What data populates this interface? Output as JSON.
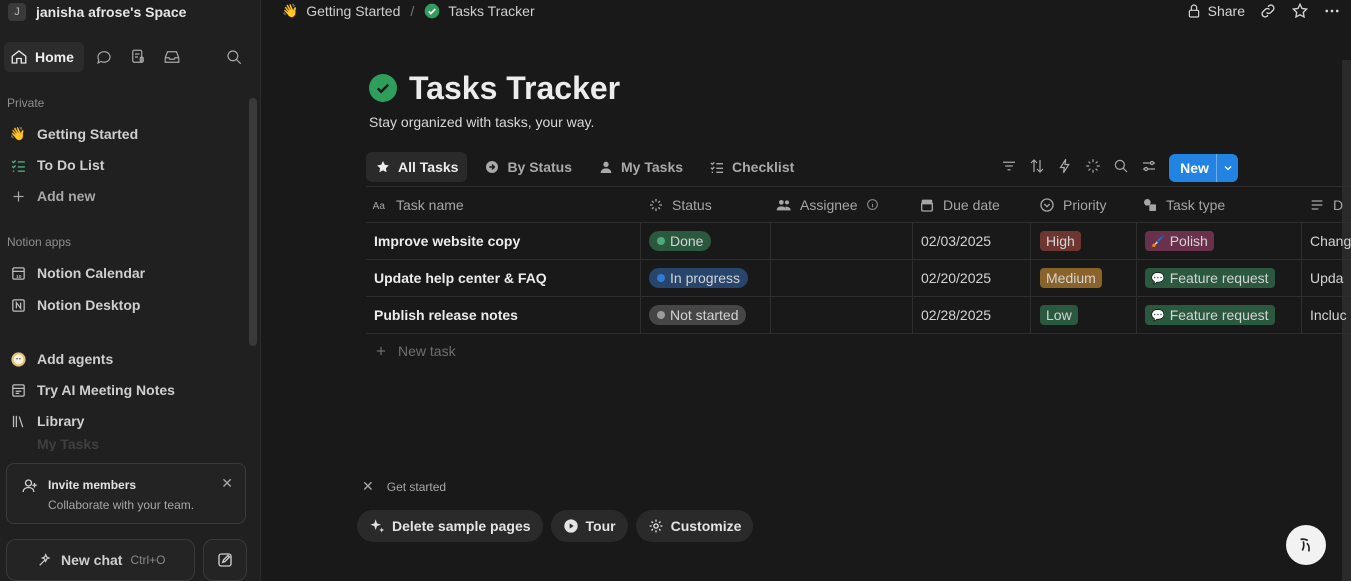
{
  "workspace": {
    "badge": "J",
    "name": "janisha afrose's Space"
  },
  "topnav": {
    "home_label": "Home"
  },
  "sidebar": {
    "private_label": "Private",
    "private_items": [
      {
        "label": "Getting Started",
        "icon": "👋"
      },
      {
        "label": "To Do List",
        "icon": "checklist-icon"
      },
      {
        "label": "Add new",
        "icon": "plus-icon"
      }
    ],
    "apps_label": "Notion apps",
    "app_items": [
      {
        "label": "Notion Calendar",
        "icon": "calendar-icon"
      },
      {
        "label": "Notion Desktop",
        "icon": "notion-icon"
      }
    ],
    "other_items": [
      {
        "label": "Add agents",
        "icon": "agent-face-icon"
      },
      {
        "label": "Try AI Meeting Notes",
        "icon": "meeting-notes-icon"
      },
      {
        "label": "Library",
        "icon": "library-icon"
      }
    ],
    "partial_item": "My Tasks",
    "invite": {
      "title": "Invite members",
      "subtitle": "Collaborate with your team."
    },
    "new_chat": {
      "label": "New chat",
      "shortcut": "Ctrl+O"
    }
  },
  "breadcrumb": {
    "items": [
      {
        "label": "Getting Started",
        "icon": "👋"
      },
      {
        "label": "Tasks Tracker",
        "icon": "check-circle-icon"
      }
    ],
    "separator": "/"
  },
  "top_actions": {
    "share_label": "Share"
  },
  "page": {
    "title": "Tasks Tracker",
    "subtitle": "Stay organized with tasks, your way."
  },
  "views": {
    "tabs": [
      {
        "label": "All Tasks",
        "icon": "star-icon",
        "active": true
      },
      {
        "label": "By Status",
        "icon": "status-arrow-icon",
        "active": false
      },
      {
        "label": "My Tasks",
        "icon": "person-icon",
        "active": false
      },
      {
        "label": "Checklist",
        "icon": "checklist-icon",
        "active": false
      }
    ],
    "new_label": "New"
  },
  "table": {
    "columns": [
      {
        "label": "Task name",
        "icon": "text-icon"
      },
      {
        "label": "Status",
        "icon": "status-spinner-icon"
      },
      {
        "label": "Assignee",
        "icon": "people-icon"
      },
      {
        "label": "Due date",
        "icon": "calendar-icon"
      },
      {
        "label": "Priority",
        "icon": "chevron-circle-icon"
      },
      {
        "label": "Task type",
        "icon": "shapes-icon"
      },
      {
        "label": "D",
        "icon": "lines-icon"
      }
    ],
    "rows": [
      {
        "task": "Improve website copy",
        "status": "Done",
        "status_bg": "#2b593f",
        "status_dot": "#4dab7a",
        "assignee": "",
        "due": "02/03/2025",
        "priority": "High",
        "priority_bg": "#6e3630",
        "type": "Polish",
        "type_icon": "🖌️",
        "type_bg": "#69314c",
        "desc": "Chang"
      },
      {
        "task": "Update help center & FAQ",
        "status": "In progress",
        "status_bg": "#28456c",
        "status_dot": "#2e7dd1",
        "assignee": "",
        "due": "02/20/2025",
        "priority": "Medium",
        "priority_bg": "#89632a",
        "type": "Feature request",
        "type_icon": "💬",
        "type_bg": "#2b593f",
        "desc": "Upda"
      },
      {
        "task": "Publish release notes",
        "status": "Not started",
        "status_bg": "#464646",
        "status_dot": "#9b9b9b",
        "assignee": "",
        "due": "02/28/2025",
        "priority": "Low",
        "priority_bg": "#2b593f",
        "type": "Feature request",
        "type_icon": "💬",
        "type_bg": "#2b593f",
        "desc": "Incluc"
      }
    ],
    "new_row_label": "New task"
  },
  "get_started": {
    "label": "Get started",
    "buttons": [
      {
        "label": "Delete sample pages",
        "icon": "sparkle-icon"
      },
      {
        "label": "Tour",
        "icon": "play-icon"
      },
      {
        "label": "Customize",
        "icon": "gear-icon"
      }
    ]
  },
  "colors": {
    "accent": "#2383e2",
    "bg": "#191919",
    "sidebar_bg": "#202020",
    "title_check": "#2f9e5c"
  }
}
